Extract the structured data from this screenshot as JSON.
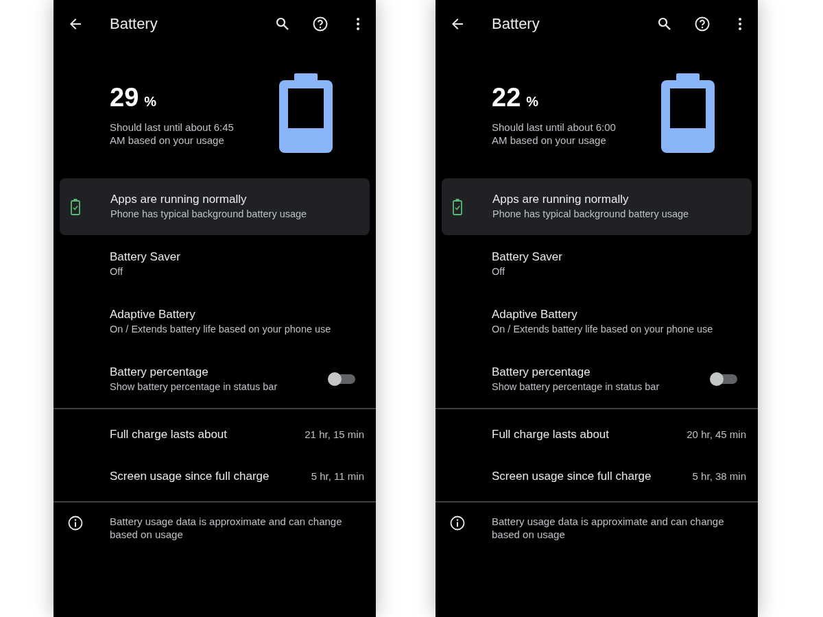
{
  "phones": [
    {
      "title": "Battery",
      "percent": "29",
      "unit": "%",
      "estimate": "Should last until about 6:45 AM based on your usage",
      "tip": {
        "title": "Apps are running normally",
        "summary": "Phone has typical background battery usage"
      },
      "settings": [
        {
          "kind": "text",
          "title": "Battery Saver",
          "summary": "Off"
        },
        {
          "kind": "text",
          "title": "Adaptive Battery",
          "summary": "On / Extends battery life based on your phone use"
        },
        {
          "kind": "toggle",
          "title": "Battery percentage",
          "summary": "Show battery percentage in status bar",
          "on": false
        }
      ],
      "stats": [
        {
          "label": "Full charge lasts about",
          "value": "21 hr, 15 min"
        },
        {
          "label": "Screen usage since full charge",
          "value": "5 hr, 11 min"
        }
      ],
      "note": "Battery usage data is approximate and can change based on usage"
    },
    {
      "title": "Battery",
      "percent": "22",
      "unit": "%",
      "estimate": "Should last until about 6:00 AM based on your usage",
      "tip": {
        "title": "Apps are running normally",
        "summary": "Phone has typical background battery usage"
      },
      "settings": [
        {
          "kind": "text",
          "title": "Battery Saver",
          "summary": "Off"
        },
        {
          "kind": "text",
          "title": "Adaptive Battery",
          "summary": "On / Extends battery life based on your phone use"
        },
        {
          "kind": "toggle",
          "title": "Battery percentage",
          "summary": "Show battery percentage in status bar",
          "on": false
        }
      ],
      "stats": [
        {
          "label": "Full charge lasts about",
          "value": "20 hr, 45 min"
        },
        {
          "label": "Screen usage since full charge",
          "value": "5 hr, 38 min"
        }
      ],
      "note": "Battery usage data is approximate and can change based on usage"
    }
  ]
}
